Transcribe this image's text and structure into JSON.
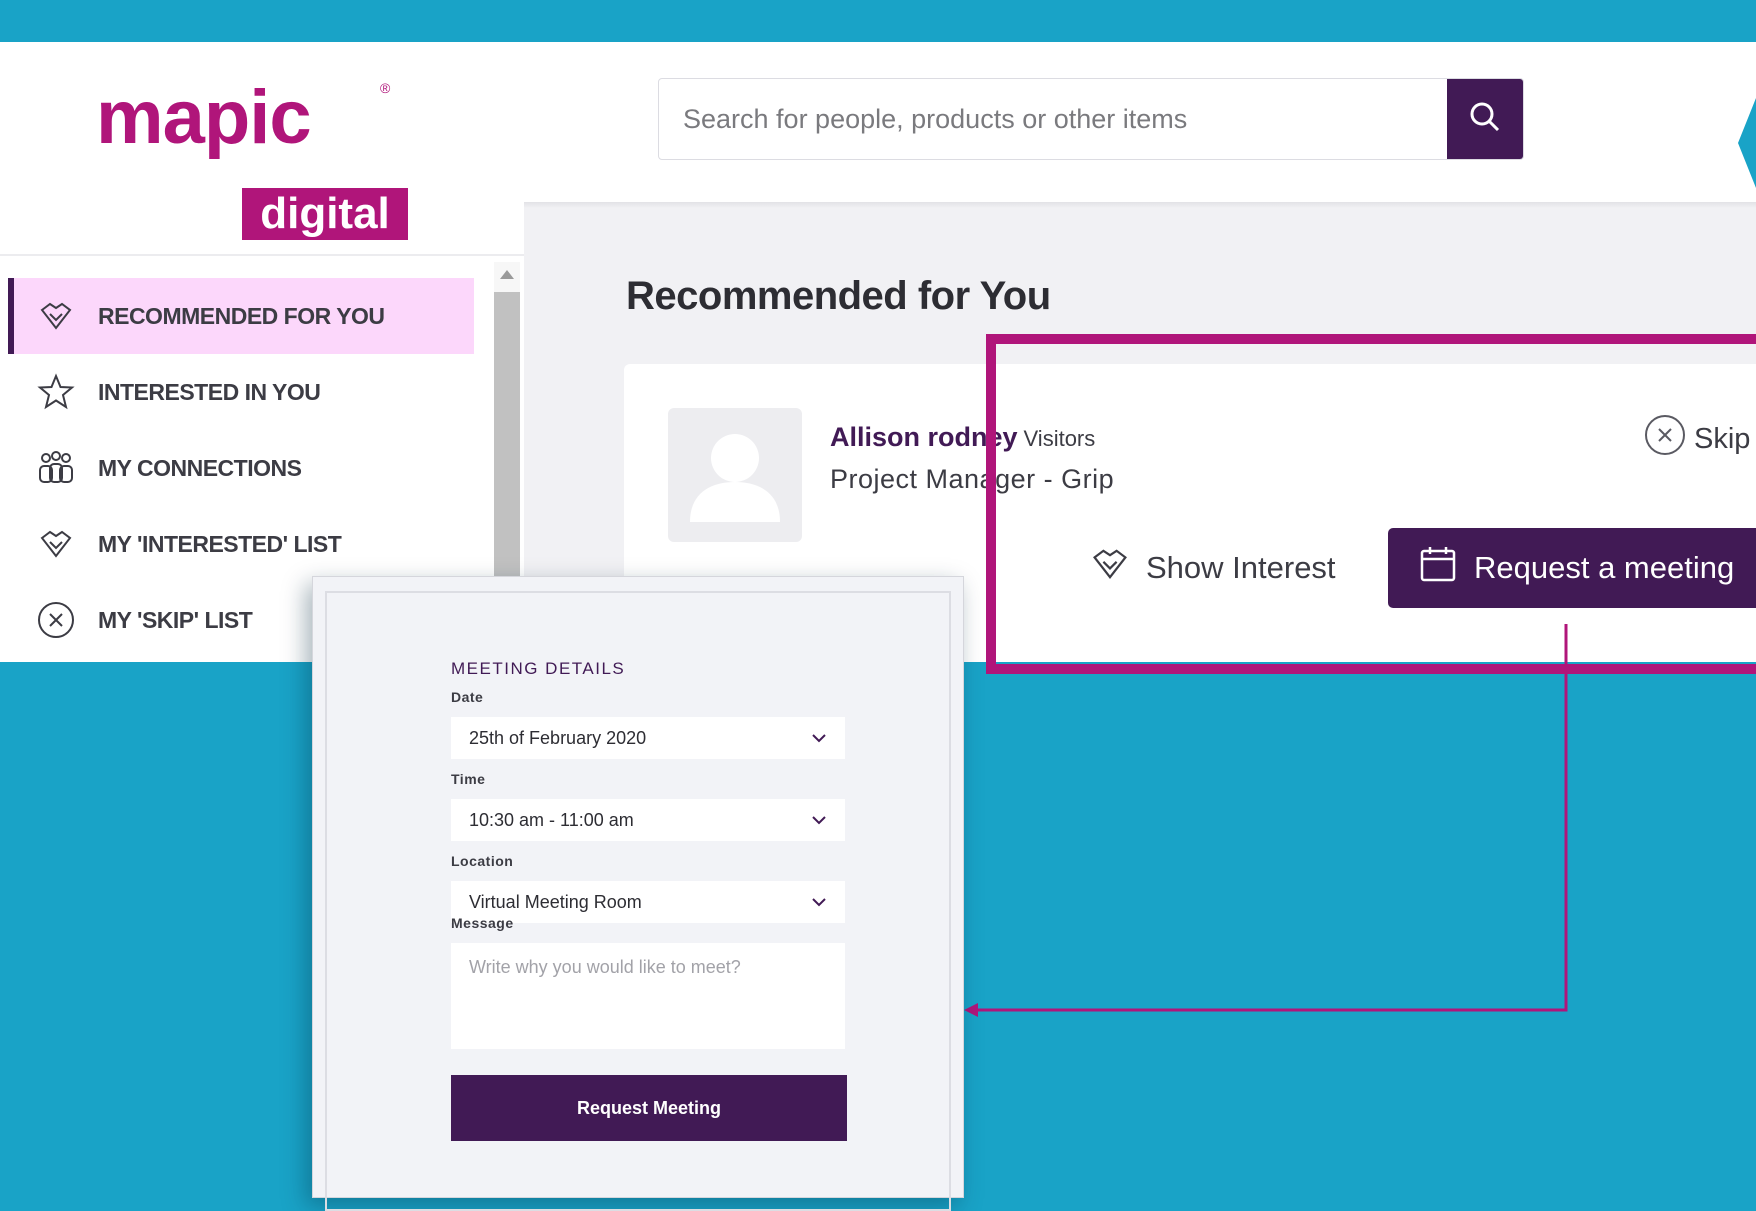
{
  "brand": {
    "logo_word": "mapic",
    "logo_tag": "digital",
    "logo_mark": "®",
    "brand_color": "#b0157a",
    "accent_color": "#411a55"
  },
  "search": {
    "placeholder": "Search for people, products or other items",
    "button_icon": "search-icon"
  },
  "sidebar": {
    "items": [
      {
        "label": "RECOMMENDED FOR YOU",
        "icon": "handshake-icon",
        "active": true
      },
      {
        "label": "INTERESTED IN YOU",
        "icon": "star-icon",
        "active": false
      },
      {
        "label": "MY CONNECTIONS",
        "icon": "people-icon",
        "active": false
      },
      {
        "label": "MY 'INTERESTED' LIST",
        "icon": "handshake-icon",
        "active": false
      },
      {
        "label": "MY 'SKIP' LIST",
        "icon": "close-circle-icon",
        "active": false
      }
    ]
  },
  "main": {
    "title": "Recommended for You",
    "card": {
      "name": "Allison rodney",
      "tag": "Visitors",
      "role": "Project Manager - Grip",
      "skip_label": "Skip",
      "show_interest_label": "Show Interest",
      "request_label": "Request a meeting"
    }
  },
  "modal": {
    "heading": "MEETING DETAILS",
    "date_label": "Date",
    "date_value": "25th of February 2020",
    "time_label": "Time",
    "time_value": "10:30 am - 11:00 am",
    "location_label": "Location",
    "location_value": "Virtual Meeting Room",
    "message_label": "Message",
    "message_placeholder": "Write why you would like to meet?",
    "submit_label": "Request Meeting"
  }
}
